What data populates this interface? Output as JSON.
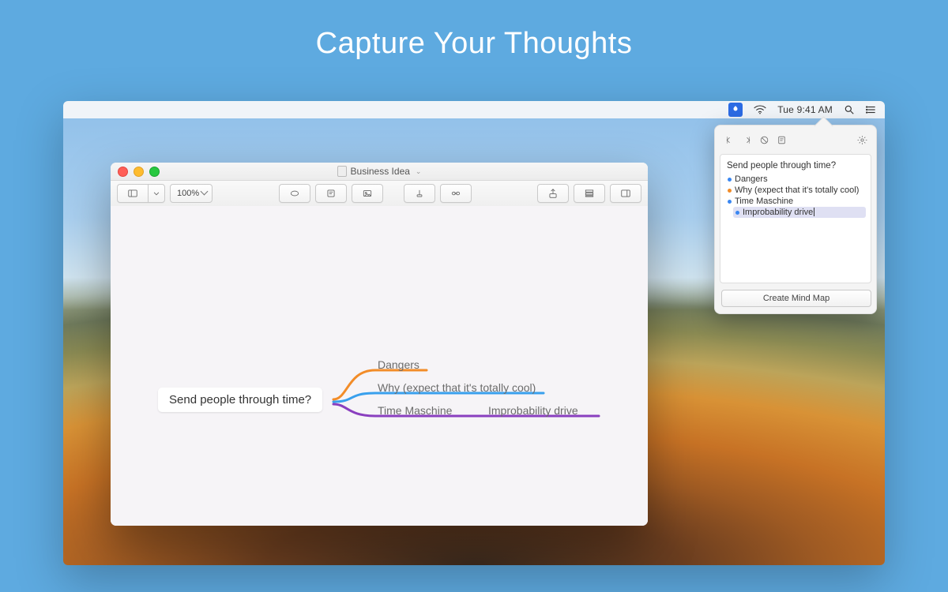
{
  "hero": {
    "title": "Capture Your Thoughts"
  },
  "menubar": {
    "clock": "Tue 9:41 AM"
  },
  "window": {
    "title": "Business Idea",
    "zoom": "100%"
  },
  "mindmap": {
    "root": "Send people through time?",
    "branch1": "Dangers",
    "branch2": "Why (expect that it's totally cool)",
    "branch3": "Time Maschine",
    "branch3_child": "Improbability drive"
  },
  "popover": {
    "root": "Send people through time?",
    "items": [
      {
        "label": "Dangers",
        "color": "blue"
      },
      {
        "label": "Why (expect that it's totally cool)",
        "color": "orange"
      },
      {
        "label": "Time Maschine",
        "color": "blue"
      }
    ],
    "subitem": "Improbability drive",
    "create_button": "Create Mind Map"
  }
}
